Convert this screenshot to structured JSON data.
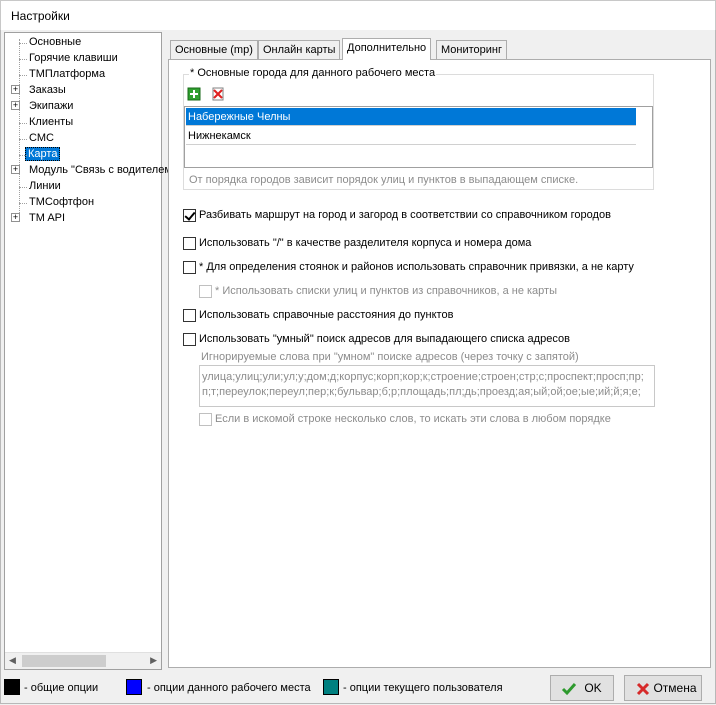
{
  "window": {
    "title": "Настройки"
  },
  "tree": {
    "items": [
      {
        "label": "Основные",
        "expandable": false
      },
      {
        "label": "Горячие клавиши",
        "expandable": false
      },
      {
        "label": "ТМПлатформа",
        "expandable": false
      },
      {
        "label": "Заказы",
        "expandable": true
      },
      {
        "label": "Экипажи",
        "expandable": true
      },
      {
        "label": "Клиенты",
        "expandable": false
      },
      {
        "label": "СМС",
        "expandable": false
      },
      {
        "label": "Карта",
        "expandable": false,
        "selected": true
      },
      {
        "label": "Модуль \"Связь с водителем\"",
        "expandable": true
      },
      {
        "label": "Линии",
        "expandable": false
      },
      {
        "label": "ТМСофтфон",
        "expandable": false
      },
      {
        "label": "TM API",
        "expandable": true
      }
    ]
  },
  "tabs": [
    {
      "label": "Основные (mp)"
    },
    {
      "label": "Онлайн карты"
    },
    {
      "label": "Дополнительно",
      "active": true
    },
    {
      "label": "Мониторинг"
    }
  ],
  "cities": {
    "group_title": "* Основные города для данного рабочего места",
    "add_icon": "add-icon",
    "delete_icon": "delete-icon",
    "items": [
      "Набережные Челны",
      "Нижнекамск"
    ],
    "selected_index": 0,
    "hint": "От порядка городов зависит порядок улиц и пунктов в выпадающем списке."
  },
  "options": {
    "split_route": {
      "label": "Разбивать маршрут на город и загород в соответствии со справочником  городов",
      "checked": true
    },
    "slash_separator": {
      "label": "Использовать \"/\" в качестве разделителя корпуса и номера дома",
      "checked": false
    },
    "binding_directory": {
      "label": "* Для определения стоянок и районов использовать справочник привязки, а не карту",
      "checked": false
    },
    "street_lists": {
      "label": "* Использовать списки улиц и пунктов из справочников, а не карты",
      "checked": false
    },
    "reference_distances": {
      "label": "Использовать справочные расстояния до пунктов",
      "checked": false
    },
    "smart_search": {
      "label": "Использовать \"умный\" поиск адресов для выпадающего списка адресов",
      "checked": false
    },
    "ignored_words_label": "Игнорируемые слова  при \"умном\" поиске адресов (через точку с запятой)",
    "ignored_words_value": "улица;улиц;ули;ул;у;дом;д;корпус;корп;кор;к;строение;строен;стр;с;проспект;просп;пр;п;т;переулок;переул;пер;к;бульвар;б;р;площадь;пл;дь;проезд;ая;ый;ой;ое;ые;ий;й;я;е;",
    "any_order": {
      "label": "Если в искомой строке несколько слов, то искать эти слова в любом порядке",
      "checked": false
    }
  },
  "legend": [
    {
      "color": "#000000",
      "label": "- общие опции"
    },
    {
      "color": "#0000ff",
      "label": "- опции данного рабочего места"
    },
    {
      "color": "#008080",
      "label": "- опции текущего пользователя"
    }
  ],
  "buttons": {
    "ok": "OK",
    "cancel": "Отмена"
  }
}
